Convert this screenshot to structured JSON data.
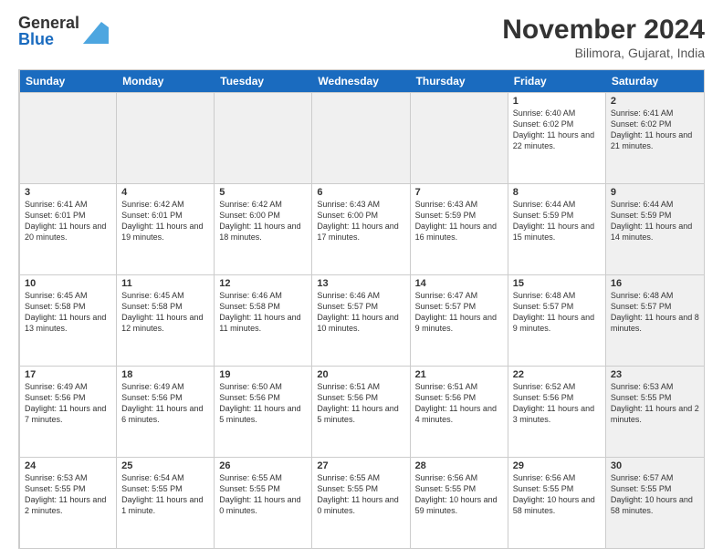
{
  "logo": {
    "general": "General",
    "blue": "Blue"
  },
  "title": "November 2024",
  "location": "Bilimora, Gujarat, India",
  "header_days": [
    "Sunday",
    "Monday",
    "Tuesday",
    "Wednesday",
    "Thursday",
    "Friday",
    "Saturday"
  ],
  "weeks": [
    [
      {
        "day": "",
        "info": "",
        "shaded": true
      },
      {
        "day": "",
        "info": "",
        "shaded": true
      },
      {
        "day": "",
        "info": "",
        "shaded": true
      },
      {
        "day": "",
        "info": "",
        "shaded": true
      },
      {
        "day": "",
        "info": "",
        "shaded": true
      },
      {
        "day": "1",
        "info": "Sunrise: 6:40 AM\nSunset: 6:02 PM\nDaylight: 11 hours and 22 minutes.",
        "shaded": false
      },
      {
        "day": "2",
        "info": "Sunrise: 6:41 AM\nSunset: 6:02 PM\nDaylight: 11 hours and 21 minutes.",
        "shaded": true
      }
    ],
    [
      {
        "day": "3",
        "info": "Sunrise: 6:41 AM\nSunset: 6:01 PM\nDaylight: 11 hours and 20 minutes.",
        "shaded": false
      },
      {
        "day": "4",
        "info": "Sunrise: 6:42 AM\nSunset: 6:01 PM\nDaylight: 11 hours and 19 minutes.",
        "shaded": false
      },
      {
        "day": "5",
        "info": "Sunrise: 6:42 AM\nSunset: 6:00 PM\nDaylight: 11 hours and 18 minutes.",
        "shaded": false
      },
      {
        "day": "6",
        "info": "Sunrise: 6:43 AM\nSunset: 6:00 PM\nDaylight: 11 hours and 17 minutes.",
        "shaded": false
      },
      {
        "day": "7",
        "info": "Sunrise: 6:43 AM\nSunset: 5:59 PM\nDaylight: 11 hours and 16 minutes.",
        "shaded": false
      },
      {
        "day": "8",
        "info": "Sunrise: 6:44 AM\nSunset: 5:59 PM\nDaylight: 11 hours and 15 minutes.",
        "shaded": false
      },
      {
        "day": "9",
        "info": "Sunrise: 6:44 AM\nSunset: 5:59 PM\nDaylight: 11 hours and 14 minutes.",
        "shaded": true
      }
    ],
    [
      {
        "day": "10",
        "info": "Sunrise: 6:45 AM\nSunset: 5:58 PM\nDaylight: 11 hours and 13 minutes.",
        "shaded": false
      },
      {
        "day": "11",
        "info": "Sunrise: 6:45 AM\nSunset: 5:58 PM\nDaylight: 11 hours and 12 minutes.",
        "shaded": false
      },
      {
        "day": "12",
        "info": "Sunrise: 6:46 AM\nSunset: 5:58 PM\nDaylight: 11 hours and 11 minutes.",
        "shaded": false
      },
      {
        "day": "13",
        "info": "Sunrise: 6:46 AM\nSunset: 5:57 PM\nDaylight: 11 hours and 10 minutes.",
        "shaded": false
      },
      {
        "day": "14",
        "info": "Sunrise: 6:47 AM\nSunset: 5:57 PM\nDaylight: 11 hours and 9 minutes.",
        "shaded": false
      },
      {
        "day": "15",
        "info": "Sunrise: 6:48 AM\nSunset: 5:57 PM\nDaylight: 11 hours and 9 minutes.",
        "shaded": false
      },
      {
        "day": "16",
        "info": "Sunrise: 6:48 AM\nSunset: 5:57 PM\nDaylight: 11 hours and 8 minutes.",
        "shaded": true
      }
    ],
    [
      {
        "day": "17",
        "info": "Sunrise: 6:49 AM\nSunset: 5:56 PM\nDaylight: 11 hours and 7 minutes.",
        "shaded": false
      },
      {
        "day": "18",
        "info": "Sunrise: 6:49 AM\nSunset: 5:56 PM\nDaylight: 11 hours and 6 minutes.",
        "shaded": false
      },
      {
        "day": "19",
        "info": "Sunrise: 6:50 AM\nSunset: 5:56 PM\nDaylight: 11 hours and 5 minutes.",
        "shaded": false
      },
      {
        "day": "20",
        "info": "Sunrise: 6:51 AM\nSunset: 5:56 PM\nDaylight: 11 hours and 5 minutes.",
        "shaded": false
      },
      {
        "day": "21",
        "info": "Sunrise: 6:51 AM\nSunset: 5:56 PM\nDaylight: 11 hours and 4 minutes.",
        "shaded": false
      },
      {
        "day": "22",
        "info": "Sunrise: 6:52 AM\nSunset: 5:56 PM\nDaylight: 11 hours and 3 minutes.",
        "shaded": false
      },
      {
        "day": "23",
        "info": "Sunrise: 6:53 AM\nSunset: 5:55 PM\nDaylight: 11 hours and 2 minutes.",
        "shaded": true
      }
    ],
    [
      {
        "day": "24",
        "info": "Sunrise: 6:53 AM\nSunset: 5:55 PM\nDaylight: 11 hours and 2 minutes.",
        "shaded": false
      },
      {
        "day": "25",
        "info": "Sunrise: 6:54 AM\nSunset: 5:55 PM\nDaylight: 11 hours and 1 minute.",
        "shaded": false
      },
      {
        "day": "26",
        "info": "Sunrise: 6:55 AM\nSunset: 5:55 PM\nDaylight: 11 hours and 0 minutes.",
        "shaded": false
      },
      {
        "day": "27",
        "info": "Sunrise: 6:55 AM\nSunset: 5:55 PM\nDaylight: 11 hours and 0 minutes.",
        "shaded": false
      },
      {
        "day": "28",
        "info": "Sunrise: 6:56 AM\nSunset: 5:55 PM\nDaylight: 10 hours and 59 minutes.",
        "shaded": false
      },
      {
        "day": "29",
        "info": "Sunrise: 6:56 AM\nSunset: 5:55 PM\nDaylight: 10 hours and 58 minutes.",
        "shaded": false
      },
      {
        "day": "30",
        "info": "Sunrise: 6:57 AM\nSunset: 5:55 PM\nDaylight: 10 hours and 58 minutes.",
        "shaded": true
      }
    ]
  ]
}
